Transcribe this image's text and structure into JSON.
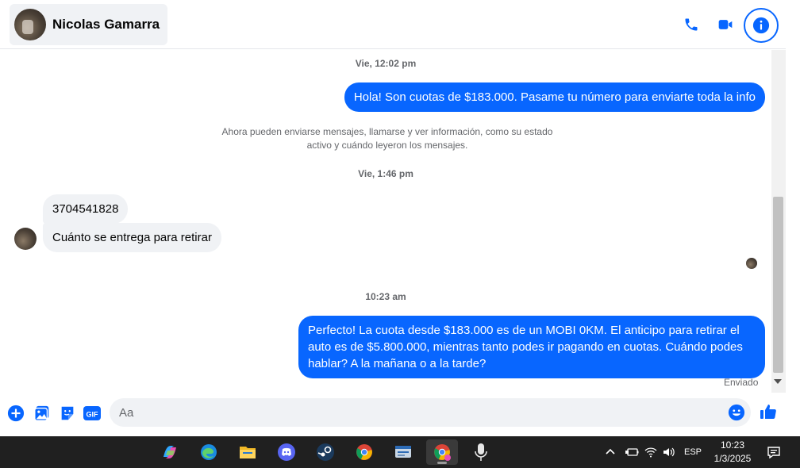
{
  "header": {
    "contact_name": "Nicolas Gamarra",
    "icons": [
      "phone-icon",
      "video-icon",
      "info-icon"
    ]
  },
  "colors": {
    "accent": "#0866ff",
    "incoming_bubble": "#f0f2f5",
    "muted_text": "#65676b",
    "taskbar": "#202020"
  },
  "conversation": {
    "timestamp_1": "Vie, 12:02 pm",
    "msg_out_1": "Hola! Son cuotas de $183.000. Pasame tu número para enviarte toda la info",
    "system_line_1": "Ahora pueden enviarse mensajes, llamarse y ver información, como su estado",
    "system_line_2": "activo y cuándo leyeron los mensajes.",
    "timestamp_2": "Vie, 1:46 pm",
    "msg_in_1": "3704541828",
    "msg_in_2": "Cuánto se entrega para retirar",
    "timestamp_3": "10:23 am",
    "msg_out_2": "Perfecto! La cuota desde $183.000 es de un MOBI 0KM. El anticipo para retirar el auto es de $5.800.000, mientras tanto podes ir pagando en cuotas. Cuándo podes hablar? A la mañana o a la tarde?",
    "status": "Enviado"
  },
  "composer": {
    "placeholder": "Aa",
    "gif_label": "GIF"
  },
  "taskbar": {
    "language": "ESP",
    "time": "10:23",
    "date": "1/3/2025"
  }
}
